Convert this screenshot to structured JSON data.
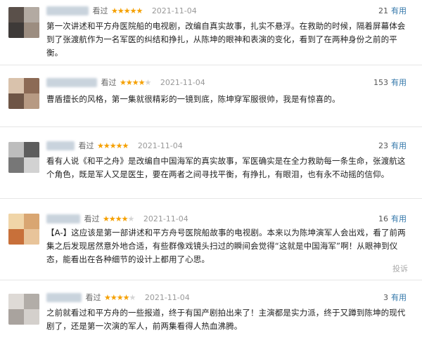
{
  "reviews": [
    {
      "watched": "看过",
      "stars": "★★★★★",
      "stars_off": "",
      "date": "2021-11-04",
      "useful_count": "21",
      "useful_label": "有用",
      "text": "第一次讲述和平方舟医院船的电视剧，改编自真实故事，扎实不悬浮。在救助的时候，隔着屏幕体会到了张渡航作为一名军医的纠结和挣扎，从陈坤的眼神和表演的变化，看到了在两种身份之前的平衡。"
    },
    {
      "watched": "看过",
      "stars": "★★★★",
      "stars_off": "★",
      "date": "2021-11-04",
      "useful_count": "153",
      "useful_label": "有用",
      "text": "曹盾擅长的风格，第一集就很精彩的一镜到底，陈坤穿军服很帅，我是有惊喜的。"
    },
    {
      "watched": "看过",
      "stars": "★★★★★",
      "stars_off": "",
      "date": "2021-11-04",
      "useful_count": "23",
      "useful_label": "有用",
      "text": "看有人说《和平之舟》是改编自中国海军的真实故事，军医确实是在全力救助每一条生命，张渡航这个角色，既是军人又是医生，要在两者之间寻找平衡，有挣扎，有眼泪，也有永不动摇的信仰。"
    },
    {
      "watched": "看过",
      "stars": "★★★★",
      "stars_off": "★",
      "date": "2021-11-04",
      "useful_count": "16",
      "useful_label": "有用",
      "text": "【A-】这应该是第一部讲述和平方舟号医院船故事的电视剧。本来以为陈坤演军人会出戏，看了前两集之后发现居然意外地合适，有些群像戏镜头扫过的瞬间会觉得“这就是中国海军”啊！从眼神到仪态，能看出在各种细节的设计上都用了心思。",
      "report": "投诉"
    },
    {
      "watched": "看过",
      "stars": "★★★★",
      "stars_off": "★",
      "date": "2021-11-04",
      "useful_count": "3",
      "useful_label": "有用",
      "text": "之前就看过和平方舟的一些报道，终于有国产剧拍出来了！主演都是实力派，终于又蹲到陈坤的现代剧了，还是第一次演的军人，前两集看得人热血沸腾。"
    }
  ],
  "colors": {
    "star": "#f5a000",
    "star_off": "#d5d5d5",
    "link": "#3377aa",
    "divider": "#e6e6e6"
  },
  "icons": [
    "avatar",
    "star-icon"
  ]
}
